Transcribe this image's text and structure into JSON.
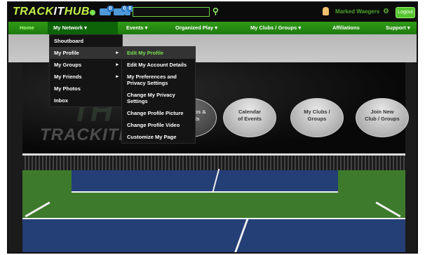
{
  "header": {
    "logo_part1": "TRACK",
    "logo_part2": "IT",
    "logo_part3": "HUB",
    "badges": [
      "0",
      "0",
      "0"
    ],
    "search_placeholder": "",
    "user_name": "Marked Waegers",
    "logout_label": "Logout"
  },
  "nav": {
    "items": [
      {
        "label": "Home"
      },
      {
        "label": "My Network ▾"
      },
      {
        "label": "Events ▾"
      },
      {
        "label": "Organized Play ▾"
      },
      {
        "label": "My Clubs / Groups ▾"
      },
      {
        "label": "Affiliations"
      },
      {
        "label": "Support ▾"
      }
    ]
  },
  "my_network_menu": {
    "items": [
      {
        "label": "Shoutboard",
        "has_submenu": false
      },
      {
        "label": "My Profile",
        "has_submenu": true
      },
      {
        "label": "My Groups",
        "has_submenu": true
      },
      {
        "label": "My Friends",
        "has_submenu": true
      },
      {
        "label": "My Photos",
        "has_submenu": false
      },
      {
        "label": "Inbox",
        "has_submenu": false
      }
    ],
    "arrow": "▸"
  },
  "profile_submenu": {
    "items": [
      {
        "label": "Edit My Profile"
      },
      {
        "label": "Edit My Account Details"
      },
      {
        "label": "My Preferences and Privacy Settings"
      },
      {
        "label": "Change My Privacy Settings"
      },
      {
        "label": "Change Profile Picture"
      },
      {
        "label": "Change Profile Video"
      },
      {
        "label": "Customize My Page"
      }
    ]
  },
  "background": {
    "watermark": "TRACKITHUB"
  },
  "bubbles": [
    {
      "line1": "Handicaps &",
      "line2": "Results"
    },
    {
      "line1": "Calendar",
      "line2": "of Events"
    },
    {
      "line1": "My Clubs /",
      "line2": "Groups"
    },
    {
      "line1": "Join New",
      "line2": "Club / Groups"
    }
  ],
  "colors": {
    "brand_green": "#2f9b17",
    "accent_lime": "#7be14e",
    "court_blue": "#243e76"
  }
}
